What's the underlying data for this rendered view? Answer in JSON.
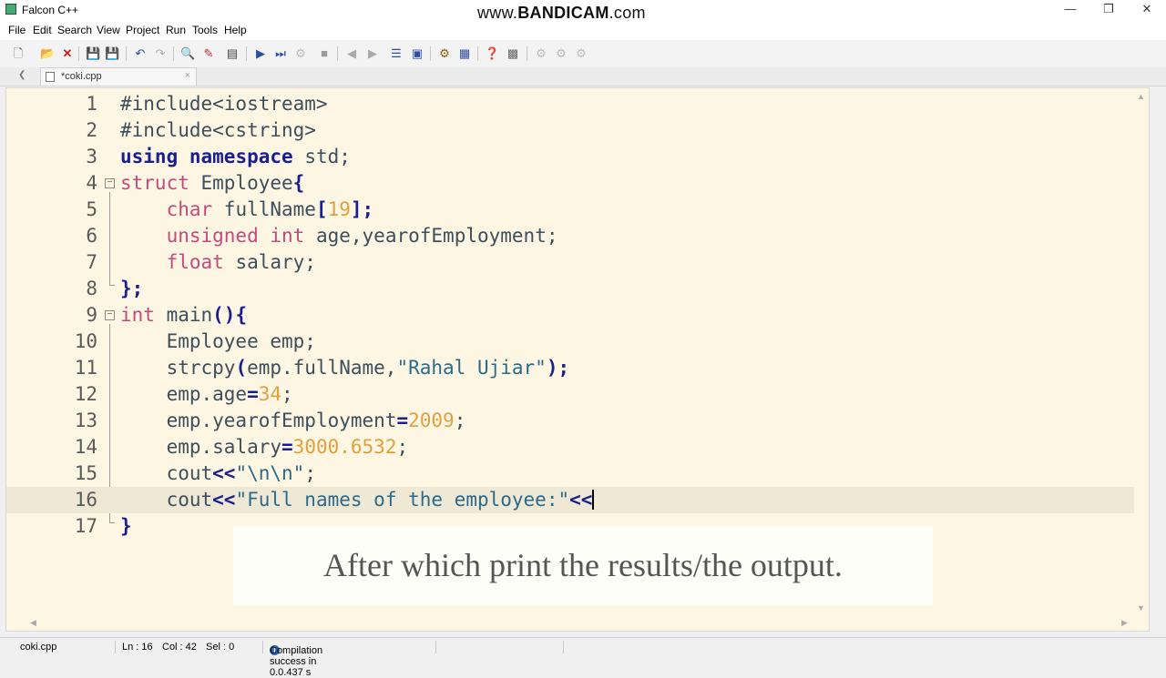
{
  "window": {
    "title": "Falcon C++",
    "watermark_prefix": "www.",
    "watermark_brand": "BANDICAM",
    "watermark_suffix": ".com"
  },
  "menu": [
    "File",
    "Edit",
    "Search",
    "View",
    "Project",
    "Run",
    "Tools",
    "Help"
  ],
  "tab": {
    "label": "*coki.cpp",
    "close": "×"
  },
  "editor": {
    "current_line": 16,
    "lines": [
      {
        "n": "1"
      },
      {
        "n": "2"
      },
      {
        "n": "3"
      },
      {
        "n": "4"
      },
      {
        "n": "5"
      },
      {
        "n": "6"
      },
      {
        "n": "7"
      },
      {
        "n": "8"
      },
      {
        "n": "9"
      },
      {
        "n": "10"
      },
      {
        "n": "11"
      },
      {
        "n": "12"
      },
      {
        "n": "13"
      },
      {
        "n": "14"
      },
      {
        "n": "15"
      },
      {
        "n": "16"
      },
      {
        "n": "17"
      }
    ],
    "code": {
      "l1": "#include<iostream>",
      "l2": "#include<cstring>",
      "l3_kw1": "using",
      "l3_kw2": "namespace",
      "l3_rest": " std;",
      "l4_kw": "struct",
      "l4_rest": " Employee",
      "l4_brace": "{",
      "l5_ty": "char",
      "l5_a": " fullName",
      "l5_b": "[",
      "l5_num": "19",
      "l5_c": "];",
      "l6_ty1": "unsigned",
      "l6_ty2": "int",
      "l6_rest": " age,yearofEmployment;",
      "l7_ty": "float",
      "l7_rest": " salary;",
      "l8": "};",
      "l9_ty": "int",
      "l9_rest": " main",
      "l9_paren": "(){",
      "l10": "Employee emp;",
      "l11_a": "strcpy",
      "l11_b": "(",
      "l11_c": "emp.fullName,",
      "l11_str": "\"Rahal Ujiar\"",
      "l11_d": ");",
      "l12_a": "emp.age",
      "l12_op": "=",
      "l12_num": "34",
      "l12_b": ";",
      "l13_a": "emp.yearofEmployment",
      "l13_op": "=",
      "l13_num": "2009",
      "l13_b": ";",
      "l14_a": "emp.salary",
      "l14_op": "=",
      "l14_num": "3000.6532",
      "l14_b": ";",
      "l15_a": "cout",
      "l15_op": "<<",
      "l15_str": "\"\\n\\n\"",
      "l15_b": ";",
      "l16_a": "cout",
      "l16_op": "<<",
      "l16_str": "\"Full names of the employee:\"",
      "l16_op2": "<<",
      "l17": "}"
    }
  },
  "caption": "After which print the results/the output.",
  "status": {
    "file": "coki.cpp",
    "ln": "Ln : 16",
    "col": "Col : 42",
    "sel": "Sel : 0",
    "message": "Compilation success in 0.0.437 s"
  },
  "icons": [
    "new-file-icon",
    "open-folder-icon",
    "close-icon",
    "save-icon",
    "save-all-icon",
    "undo-icon",
    "redo-icon",
    "find-icon",
    "replace-icon",
    "goto-icon",
    "run-icon",
    "step-icon",
    "debug-icon",
    "stop-icon",
    "back-icon",
    "forward-icon",
    "list-icon",
    "properties-icon",
    "compile-icon",
    "options-icon",
    "help-icon",
    "package-icon"
  ]
}
